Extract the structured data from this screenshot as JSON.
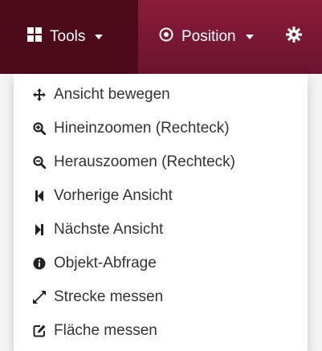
{
  "navbar": {
    "tools_label": "Tools",
    "position_label": "Position"
  },
  "menu": {
    "items": [
      {
        "label": "Ansicht bewegen",
        "icon": "move-icon"
      },
      {
        "label": "Hineinzoomen (Rechteck)",
        "icon": "zoom-in-icon"
      },
      {
        "label": "Herauszoomen (Rechteck)",
        "icon": "zoom-out-icon"
      },
      {
        "label": "Vorherige Ansicht",
        "icon": "step-backward-icon"
      },
      {
        "label": "Nächste Ansicht",
        "icon": "step-forward-icon"
      },
      {
        "label": "Objekt-Abfrage",
        "icon": "info-icon"
      },
      {
        "label": "Strecke messen",
        "icon": "resize-diagonal-icon"
      },
      {
        "label": "Fläche messen",
        "icon": "edit-square-icon"
      }
    ]
  },
  "colors": {
    "navbar": "#7a1734",
    "navbar_active": "#4d0a1b",
    "menu_text": "#333333"
  }
}
